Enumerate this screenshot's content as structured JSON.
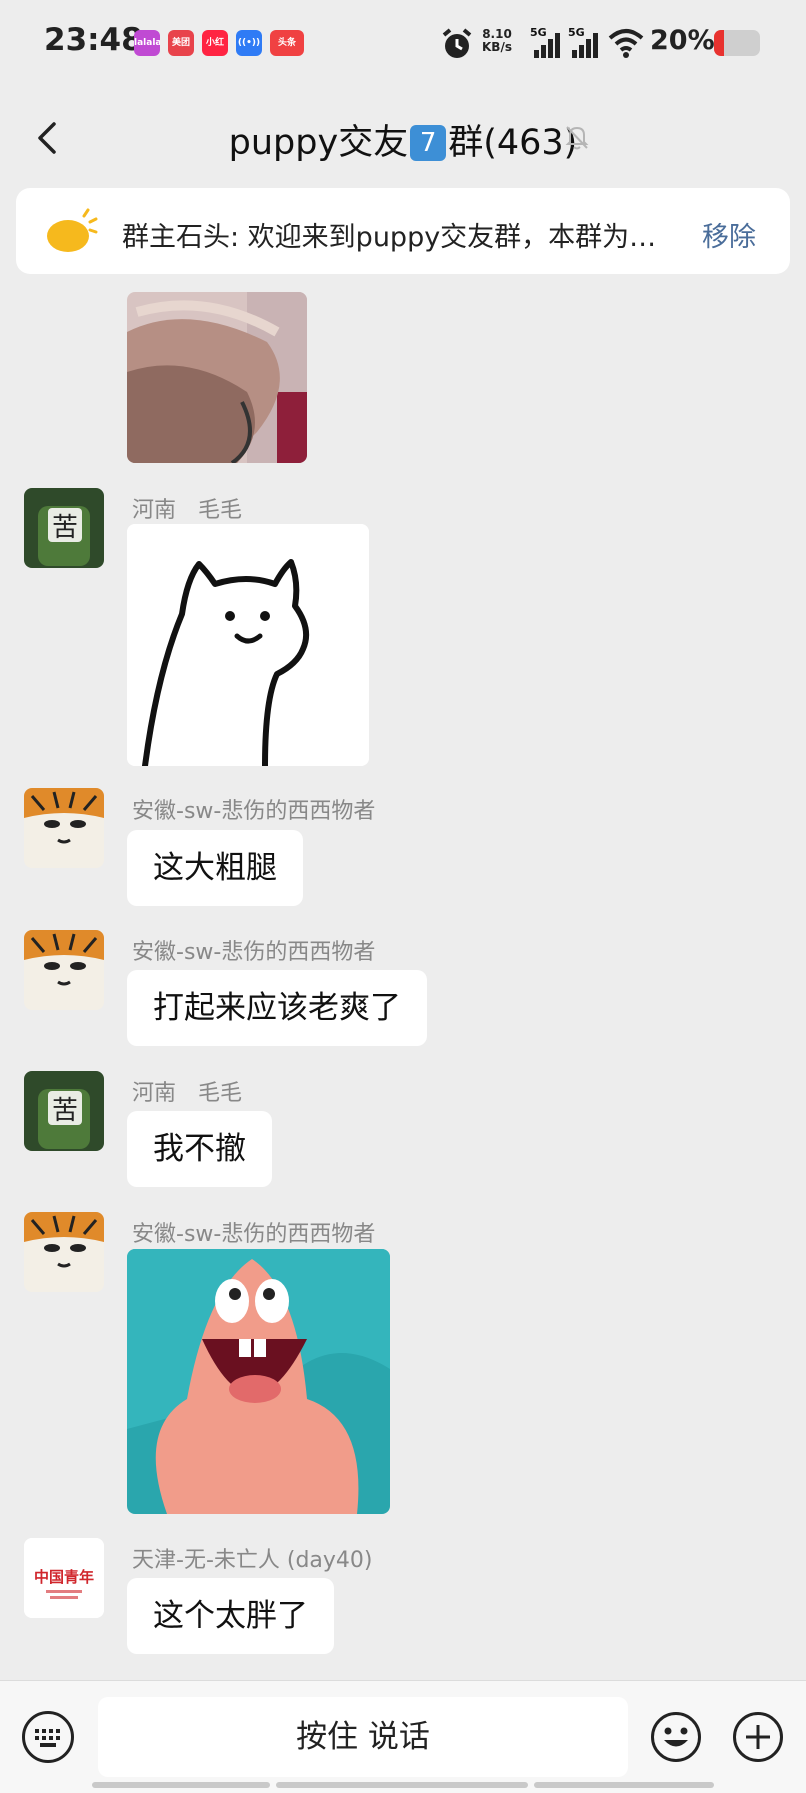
{
  "status": {
    "time": "23:48",
    "net_speed_value": "8.10",
    "net_speed_unit": "KB/s",
    "signal1": "5G",
    "signal2": "5G",
    "battery": "20%",
    "app_icons": [
      {
        "label": "lalala",
        "color": "#c04ad3"
      },
      {
        "label": "美团",
        "color": "#e8434b"
      },
      {
        "label": "小红书",
        "color": "#ff2442"
      },
      {
        "label": "((•))",
        "color": "#2f7bf5"
      },
      {
        "label": "头条",
        "color": "#f04142"
      }
    ]
  },
  "header": {
    "title_prefix": "puppy交友",
    "title_badge": "7",
    "title_suffix": "群(463)"
  },
  "notice": {
    "text": "群主石头: 欢迎来到puppy交友群，本群为…",
    "remove": "移除"
  },
  "messages": [
    {
      "type": "image",
      "desc": "photo-legs"
    },
    {
      "type": "image",
      "sender": "河南　毛毛",
      "desc": "cat-doodle"
    },
    {
      "type": "text",
      "sender": "安徽-sw-悲伤的西西物者",
      "text": "这大粗腿"
    },
    {
      "type": "text",
      "sender": "安徽-sw-悲伤的西西物者",
      "text": "打起来应该老爽了"
    },
    {
      "type": "text",
      "sender": "河南　毛毛",
      "text": "我不撤"
    },
    {
      "type": "image",
      "sender": "安徽-sw-悲伤的西西物者",
      "desc": "patrick-star"
    },
    {
      "type": "text",
      "sender": "天津-无-未亡人 (day40)",
      "text": "这个太胖了"
    }
  ],
  "avatars": {
    "henan": {
      "glyph": "苦",
      "color": "#3d6b2e"
    },
    "anhui": {
      "color": "#e08a2a"
    },
    "tianjin": {
      "glyph": "中国青年",
      "color": "#d0262c"
    }
  },
  "input": {
    "talk_label": "按住 说话"
  },
  "colors": {
    "background": "#ededed",
    "bubble": "#ffffff",
    "link": "#4a6d9a"
  }
}
